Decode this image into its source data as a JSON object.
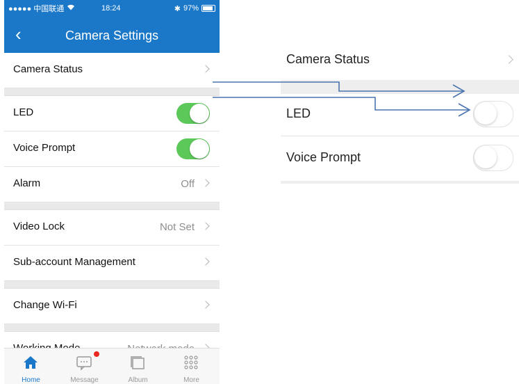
{
  "status_bar": {
    "carrier": "●●●●● 中国联通",
    "time": "18:24",
    "battery": "97%"
  },
  "nav": {
    "back_icon": "‹",
    "title": "Camera Settings"
  },
  "settings": {
    "camera_status": "Camera Status",
    "led": {
      "label": "LED",
      "on": true
    },
    "voice_prompt": {
      "label": "Voice Prompt",
      "on": true
    },
    "alarm": {
      "label": "Alarm",
      "value": "Off"
    },
    "video_lock": {
      "label": "Video Lock",
      "value": "Not Set"
    },
    "sub_account": "Sub-account Management",
    "change_wifi": "Change Wi-Fi",
    "working_mode": {
      "label": "Working Mode",
      "value": "Network mode"
    }
  },
  "tabs": [
    {
      "label": "Home",
      "icon": "home-icon",
      "active": true
    },
    {
      "label": "Message",
      "icon": "message-icon",
      "badge": true
    },
    {
      "label": "Album",
      "icon": "album-icon"
    },
    {
      "label": "More",
      "icon": "more-grid-icon"
    }
  ],
  "zoom": {
    "camera_status": "Camera Status",
    "led": {
      "label": "LED",
      "on": false
    },
    "voice_prompt": {
      "label": "Voice Prompt",
      "on": false
    }
  },
  "colors": {
    "nav_blue": "#1b78c9",
    "toggle_green": "#5cc85a",
    "arrow_blue": "#4a74b0",
    "badge_red": "#e8281f"
  }
}
